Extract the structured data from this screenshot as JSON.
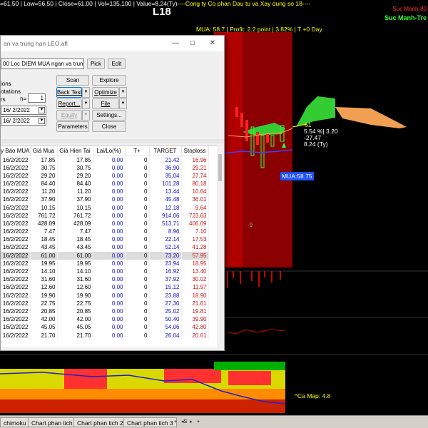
{
  "ticker": {
    "prefix": "=61.50 | Low=56.50 | Close=61.00 | Vol=135,100 | Value=8.24(Ty)",
    "company": "----Cong ty Co phan Dau tu va Xay dung so 18----"
  },
  "symbol": "L18",
  "buy_info": "MUA:  58.7 | Profit: 2.2 point | 3.82% | T +0 Day",
  "strength_1": "Suc Manh-80",
  "strength_2": "Suc Manh-Tre",
  "chart_labels": {
    "price": "61",
    "pct": "5.54 %| 3.20",
    "neg": "-27.47",
    "value": "8.24 (Ty)",
    "mua_tag": "MUA:58.75",
    "nine": "-9",
    "cap_map": "^Ca Map: 4.8"
  },
  "colors": {
    "panel_red": "#8b0000",
    "cloud_green": "#33cc33",
    "cloud_orange": "#f0a050",
    "yellow": "#ffff00"
  },
  "dialog": {
    "title": "an va trung han LEO.afl",
    "formula": "00 Loc DIEM MUA ngan va trung hai",
    "side_labels": [
      "ions",
      "otations",
      "rs"
    ],
    "n_label": "n=",
    "n_value": "1",
    "date1": "16/  2/2022",
    "date2": "16/  2/2022",
    "buttons": {
      "pick": "Pick",
      "edit": "Edit",
      "scan": "Scan",
      "explore": "Explore",
      "backtest": "Back Test",
      "optimize": "Optimize",
      "report": "Report...",
      "file": "File",
      "equity": "Equity",
      "settings": "Settings...",
      "parameters": "Parameters",
      "close": "Close"
    },
    "columns": [
      "y Báo MUA",
      "Giá Mua",
      "Giá Hien Tai",
      "Lai/Lo(%)",
      "T+",
      "TARGET",
      "Stoploss"
    ],
    "rows": [
      [
        "16/2/2022",
        "17.85",
        "17.85",
        "0.00",
        "0",
        "21.42",
        "16.96"
      ],
      [
        "16/2/2022",
        "30.75",
        "30.75",
        "0.00",
        "0",
        "36.90",
        "29.21"
      ],
      [
        "16/2/2022",
        "29.20",
        "29.20",
        "0.00",
        "0",
        "35.04",
        "27.74"
      ],
      [
        "16/2/2022",
        "84.40",
        "84.40",
        "0.00",
        "0",
        "101.28",
        "80.18"
      ],
      [
        "16/2/2022",
        "11.20",
        "11.20",
        "0.00",
        "0",
        "13.44",
        "10.64"
      ],
      [
        "16/2/2022",
        "37.90",
        "37.90",
        "0.00",
        "0",
        "45.48",
        "36.01"
      ],
      [
        "16/2/2022",
        "10.15",
        "10.15",
        "0.00",
        "0",
        "12.18",
        "9.64"
      ],
      [
        "16/2/2022",
        "761.72",
        "761.72",
        "0.00",
        "0",
        "914.06",
        "723.63"
      ],
      [
        "16/2/2022",
        "428.09",
        "428.09",
        "0.00",
        "0",
        "513.71",
        "406.69"
      ],
      [
        "16/2/2022",
        "7.47",
        "7.47",
        "0.00",
        "0",
        "8.96",
        "7.10"
      ],
      [
        "16/2/2022",
        "18.45",
        "18.45",
        "0.00",
        "0",
        "22.14",
        "17.53"
      ],
      [
        "16/2/2022",
        "43.45",
        "43.45",
        "0.00",
        "0",
        "52.14",
        "41.28"
      ],
      [
        "16/2/2022",
        "61.00",
        "61.00",
        "0.00",
        "0",
        "73.20",
        "57.95"
      ],
      [
        "16/2/2022",
        "19.95",
        "19.95",
        "0.00",
        "0",
        "23.94",
        "18.95"
      ],
      [
        "16/2/2022",
        "14.10",
        "14.10",
        "0.00",
        "0",
        "16.92",
        "13.40"
      ],
      [
        "16/2/2022",
        "31.60",
        "31.60",
        "0.00",
        "0",
        "37.92",
        "30.02"
      ],
      [
        "16/2/2022",
        "12.60",
        "12.60",
        "0.00",
        "0",
        "15.12",
        "11.97"
      ],
      [
        "16/2/2022",
        "19.90",
        "19.90",
        "0.00",
        "0",
        "23.88",
        "18.90"
      ],
      [
        "16/2/2022",
        "22.75",
        "22.75",
        "0.00",
        "0",
        "27.30",
        "21.61"
      ],
      [
        "16/2/2022",
        "20.85",
        "20.85",
        "0.00",
        "0",
        "25.02",
        "19.81"
      ],
      [
        "16/2/2022",
        "42.00",
        "42.00",
        "0.00",
        "0",
        "50.40",
        "39.90"
      ],
      [
        "16/2/2022",
        "45.05",
        "45.05",
        "0.00",
        "0",
        "54.06",
        "42.80"
      ],
      [
        "16/2/2022",
        "21.70",
        "21.70",
        "0.00",
        "0",
        "26.04",
        "20.61"
      ]
    ],
    "highlight_row": 12
  },
  "tabs": [
    "chimoku",
    "Chart phan tich",
    "Chart phan tich 2",
    "Chart phan tich 3"
  ],
  "tab_nav": [
    "+",
    "◂S",
    "▸",
    "+"
  ]
}
